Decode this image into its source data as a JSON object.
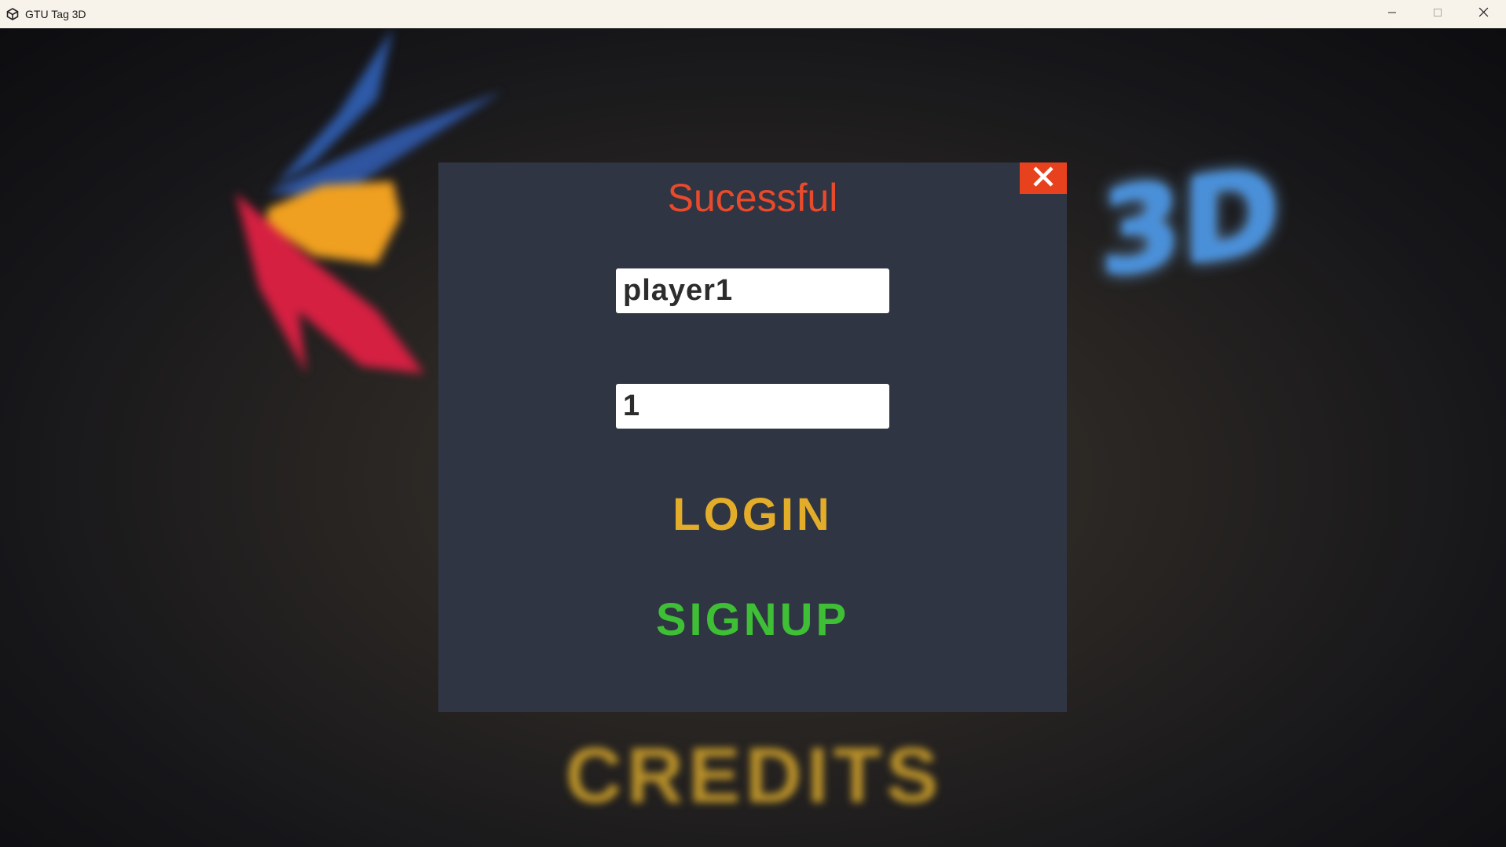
{
  "window": {
    "title": "GTU Tag 3D",
    "icon": "unity-icon",
    "controls": [
      "minimize-icon",
      "maximize-icon",
      "close-icon"
    ]
  },
  "background": {
    "logo_3d": "3D",
    "credits_label": "CREDITS"
  },
  "dialog": {
    "status_text": "Sucessful",
    "status_color": "#e84a2c",
    "close_icon": "close-icon",
    "username_value": "player1",
    "password_value": "1",
    "login_label": "LOGIN",
    "login_color": "#e3ad2a",
    "signup_label": "SIGNUP",
    "signup_color": "#3fbf35"
  }
}
